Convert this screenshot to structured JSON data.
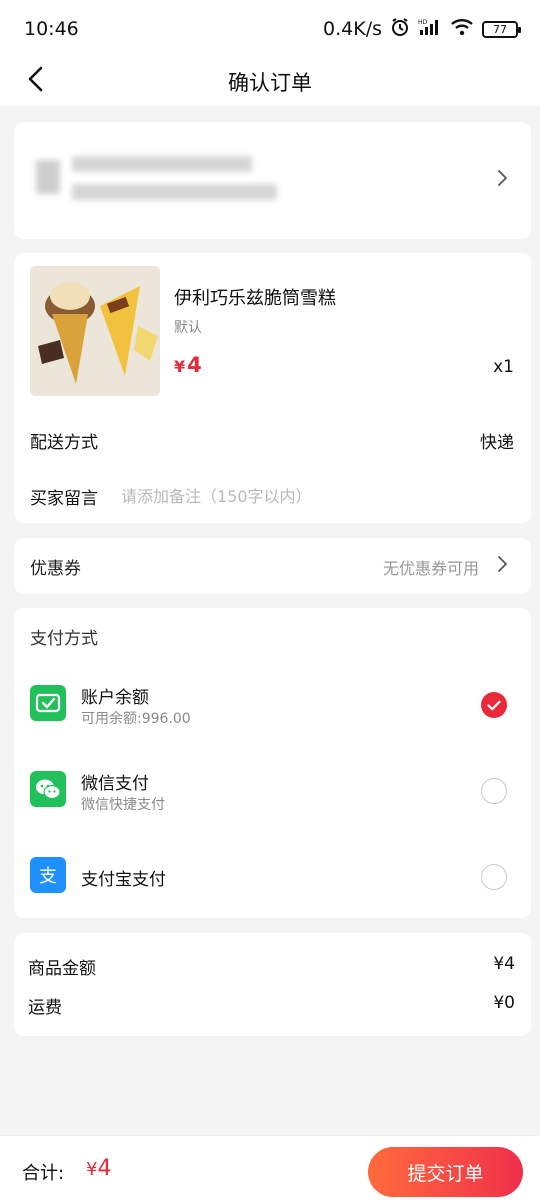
{
  "status_bar": {
    "time": "10:46",
    "network_speed": "0.4K/s",
    "battery": "77",
    "icons": [
      "alarm-icon",
      "hd-signal-icon",
      "wifi-icon",
      "battery-icon"
    ]
  },
  "header": {
    "title": "确认订单",
    "back_icon": "chevron-left-icon"
  },
  "address": {
    "content_obscured": true,
    "arrow_icon": "chevron-right-icon"
  },
  "product": {
    "name": "伊利巧乐兹脆筒雪糕",
    "spec": "默认",
    "price_symbol": "¥",
    "price": "4",
    "quantity": "x1"
  },
  "delivery": {
    "label": "配送方式",
    "value": "快递"
  },
  "remark": {
    "label": "买家留言",
    "placeholder": "请添加备注（150字以内）"
  },
  "coupon": {
    "label": "优惠券",
    "value": "无优惠券可用"
  },
  "payment": {
    "title": "支付方式",
    "options": [
      {
        "label": "账户余额",
        "sub": "可用余额:996.00",
        "icon": "wallet-icon",
        "selected": true,
        "color": "#22c05a"
      },
      {
        "label": "微信支付",
        "sub": "微信快捷支付",
        "icon": "wechat-icon",
        "selected": false,
        "color": "#22c05a"
      },
      {
        "label": "支付宝支付",
        "sub": "",
        "icon": "alipay-icon",
        "selected": false,
        "color": "#1e90ff"
      }
    ]
  },
  "summary": {
    "goods_label": "商品金额",
    "goods_value": "¥4",
    "shipping_label": "运费",
    "shipping_value": "¥0"
  },
  "footer": {
    "total_label": "合计:",
    "total_symbol": "¥",
    "total_value": "4",
    "submit_label": "提交订单"
  },
  "colors": {
    "accent": "#e8293a",
    "button_gradient_start": "#ff6a3d",
    "button_gradient_end": "#f0304a",
    "background": "#f4f4f4"
  }
}
